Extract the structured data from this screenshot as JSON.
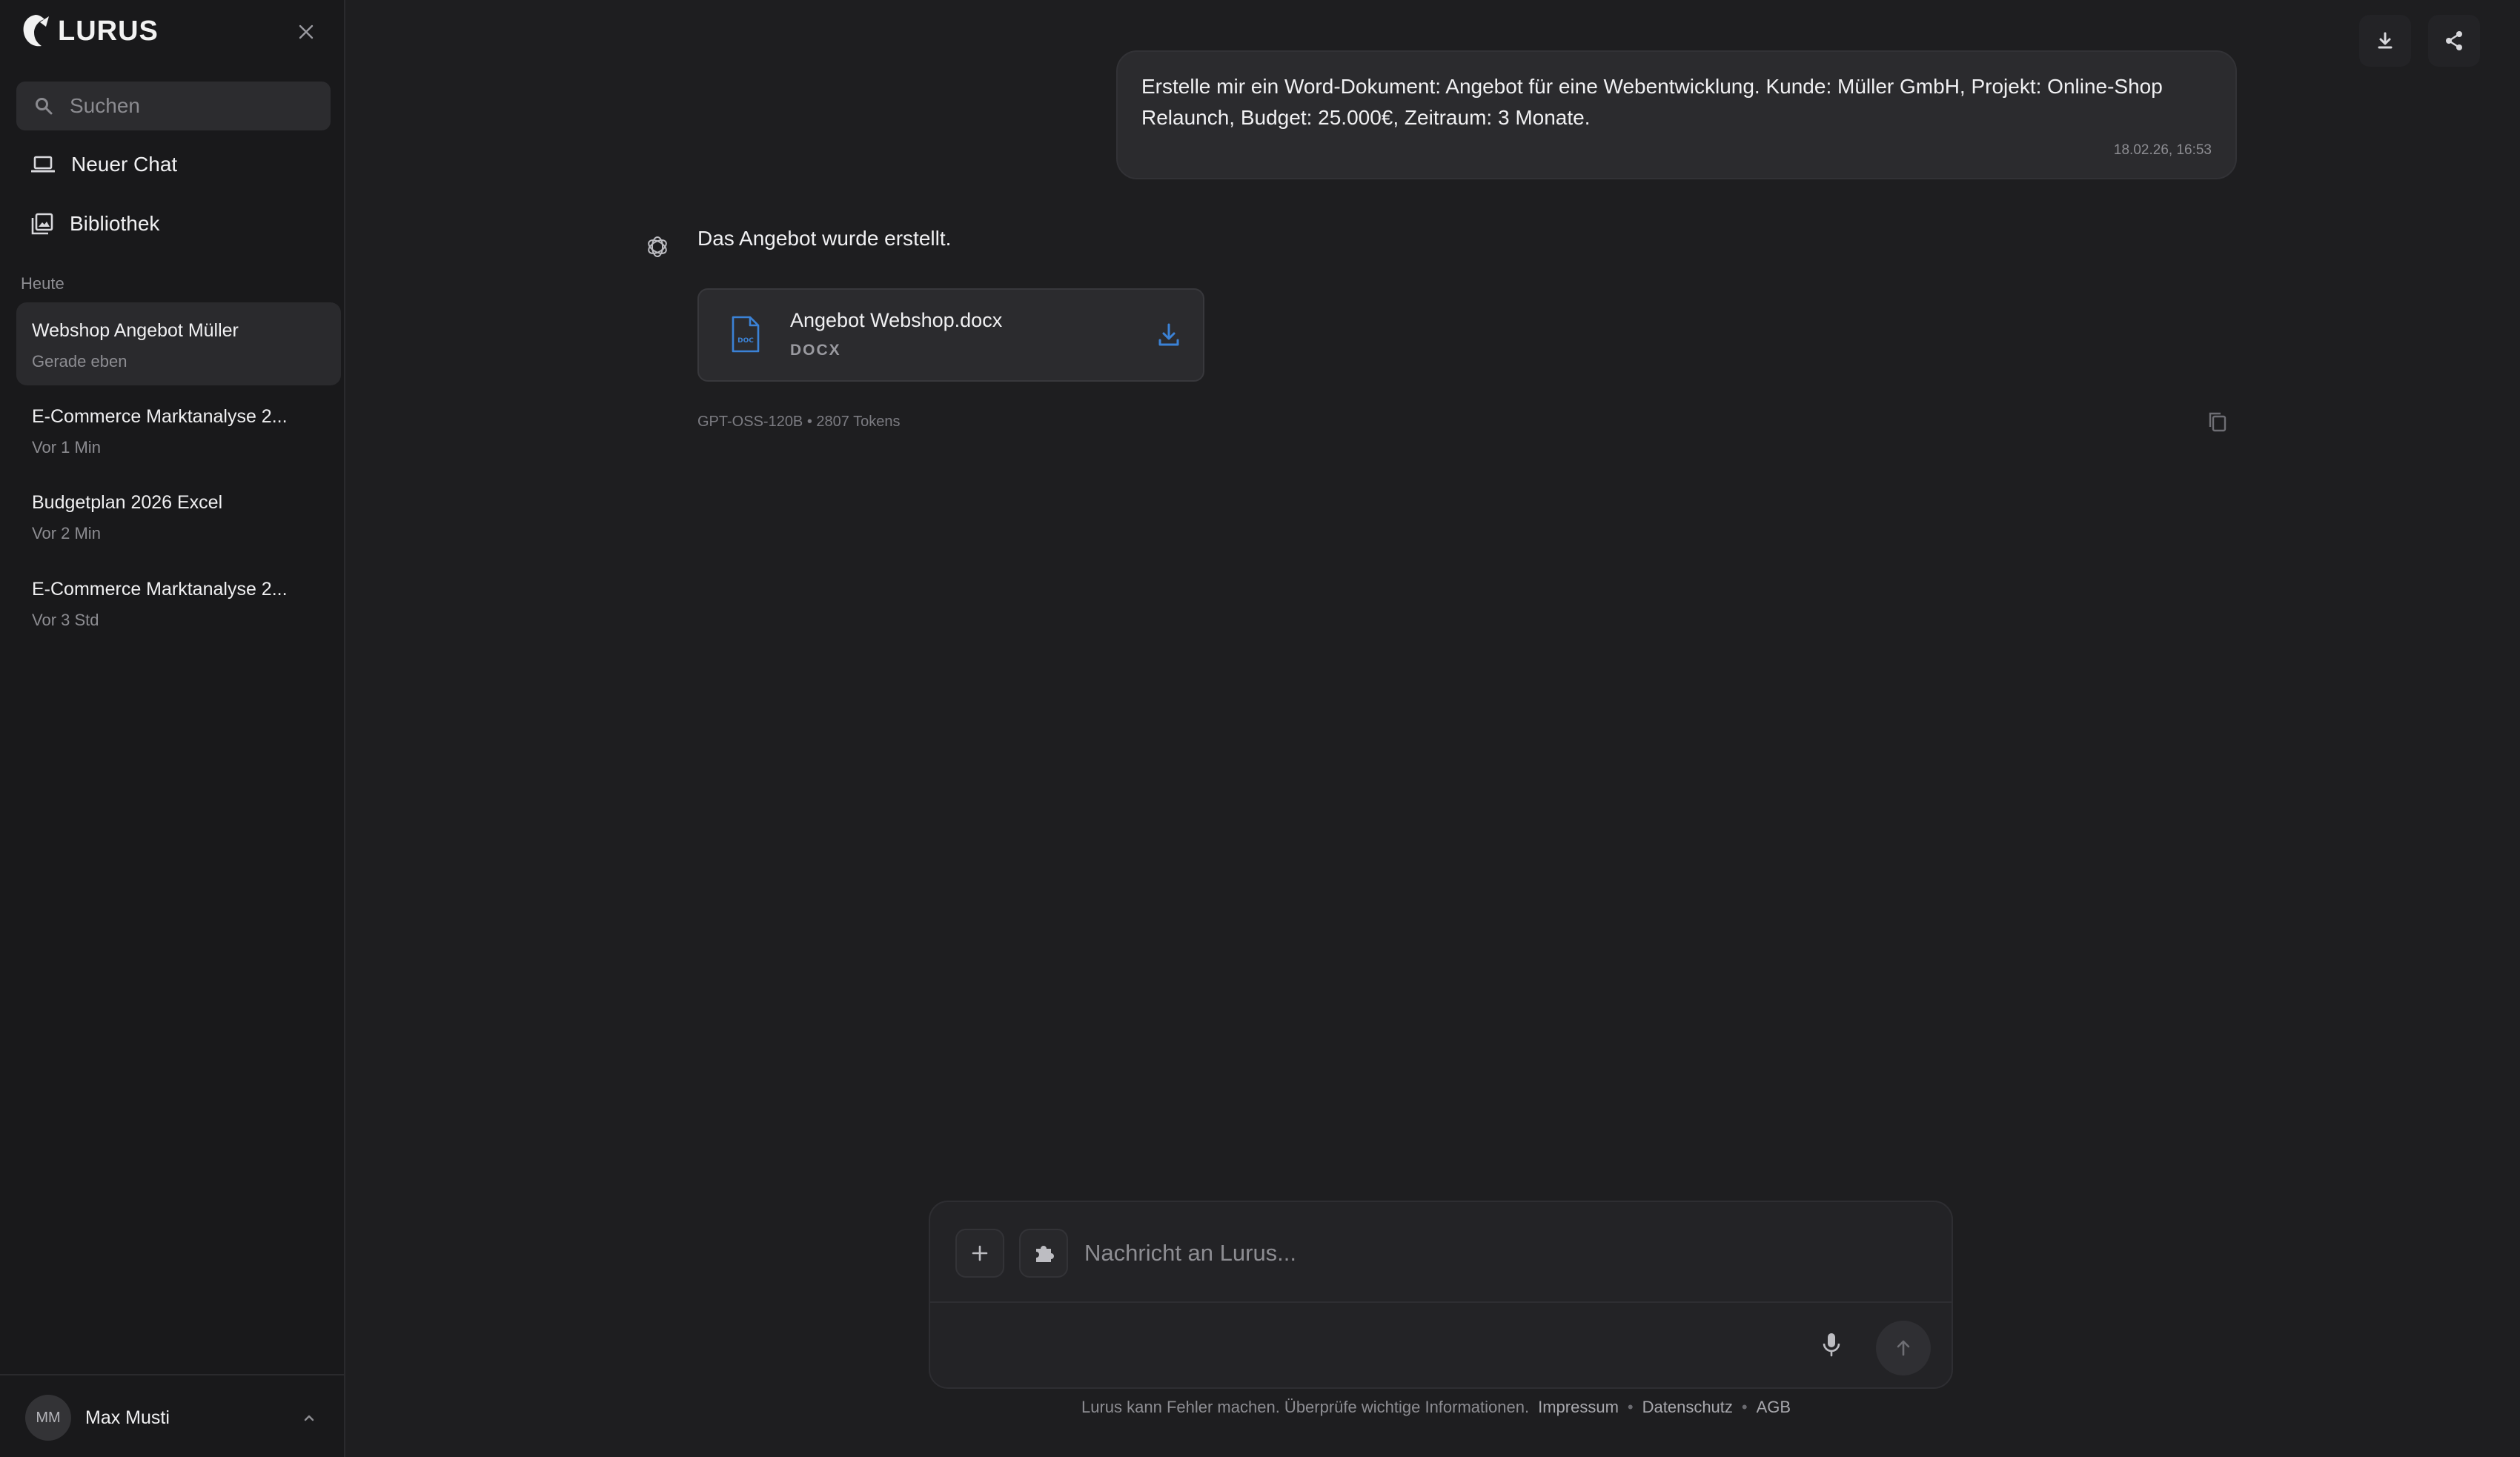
{
  "brand": {
    "name": "LURUS"
  },
  "sidebar": {
    "search_placeholder": "Suchen",
    "nav": [
      {
        "label": "Neuer Chat",
        "icon": "laptop-icon"
      },
      {
        "label": "Bibliothek",
        "icon": "library-icon"
      }
    ],
    "section_label": "Heute",
    "chats": [
      {
        "title": "Webshop Angebot Müller",
        "time": "Gerade eben",
        "active": true
      },
      {
        "title": "E-Commerce Marktanalyse 2...",
        "time": "Vor 1 Min"
      },
      {
        "title": "Budgetplan 2026 Excel",
        "time": "Vor 2 Min"
      },
      {
        "title": "E-Commerce Marktanalyse 2...",
        "time": "Vor 3 Std"
      }
    ],
    "user": {
      "initials": "MM",
      "name": "Max Musti"
    }
  },
  "conversation": {
    "user_message": {
      "text": "Erstelle mir ein Word-Dokument: Angebot für eine Webentwicklung. Kunde: Müller GmbH, Projekt: Online-Shop Relaunch, Budget: 25.000€, Zeitraum: 3 Monate.",
      "timestamp": "18.02.26, 16:53"
    },
    "bot_message": {
      "text": "Das Angebot wurde erstellt.",
      "file": {
        "name": "Angebot Webshop.docx",
        "type": "DOCX",
        "icon_label": "DOC"
      },
      "meta": "GPT-OSS-120B • 2807 Tokens"
    }
  },
  "composer": {
    "placeholder": "Nachricht an Lurus..."
  },
  "footer": {
    "disclaimer": "Lurus kann Fehler machen. Überprüfe wichtige Informationen.",
    "links": [
      "Impressum",
      "Datenschutz",
      "AGB"
    ],
    "separator": "•"
  },
  "colors": {
    "accent": "#3b82d6",
    "background": "#1e1e20",
    "sidebar": "#19191b"
  }
}
